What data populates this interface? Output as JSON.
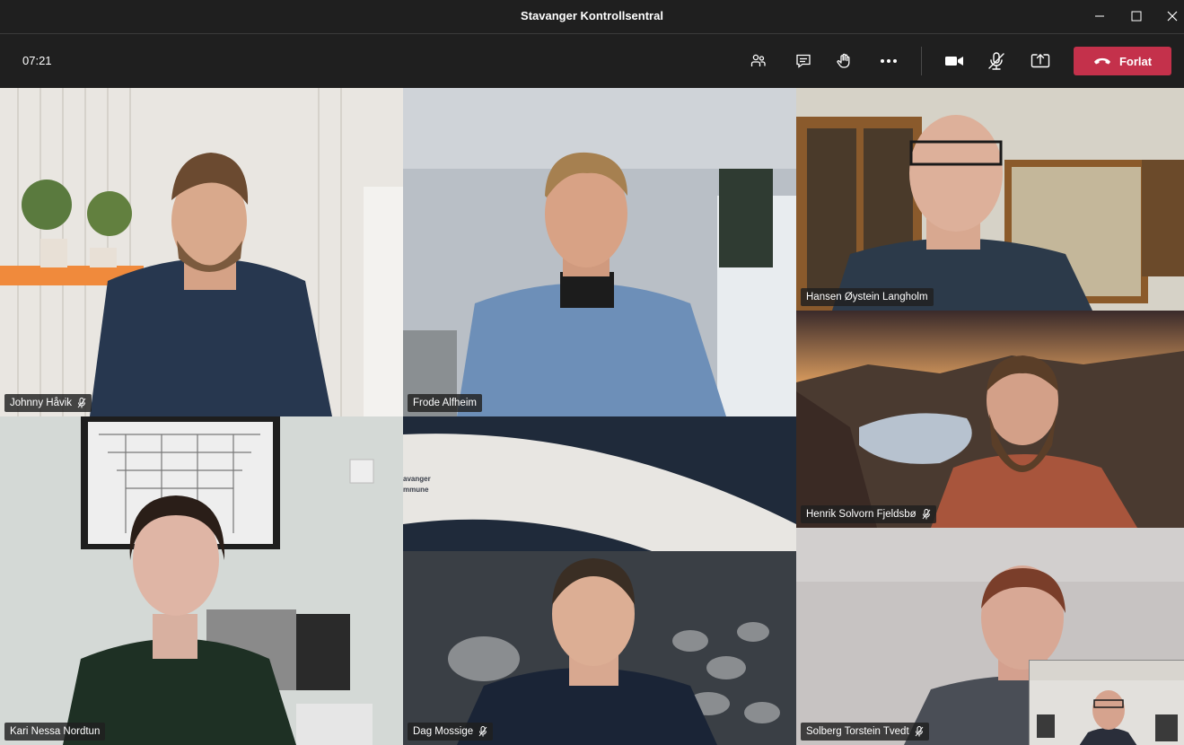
{
  "window": {
    "title": "Stavanger Kontrollsentral"
  },
  "toolbar": {
    "timer": "07:21",
    "leave_label": "Forlat",
    "icons": [
      "participants-icon",
      "chat-icon",
      "raise-hand-icon",
      "more-options-icon",
      "camera-icon",
      "microphone-muted-icon",
      "share-screen-icon",
      "hang-up-icon"
    ],
    "leave_color": "#c4314b"
  },
  "participants": [
    {
      "name": "Johnny Håvik",
      "muted": true
    },
    {
      "name": "Frode Alfheim",
      "muted": false
    },
    {
      "name": "Hansen Øystein Langholm",
      "muted": false
    },
    {
      "name": "Henrik Solvorn Fjeldsbø",
      "muted": true
    },
    {
      "name": "Kari Nessa Nordtun",
      "muted": false
    },
    {
      "name": "Dag Mossige",
      "muted": true
    },
    {
      "name": "Solberg Torstein Tvedt",
      "muted": true
    }
  ],
  "background_text": {
    "line1": "avanger",
    "line2": "mmune"
  }
}
